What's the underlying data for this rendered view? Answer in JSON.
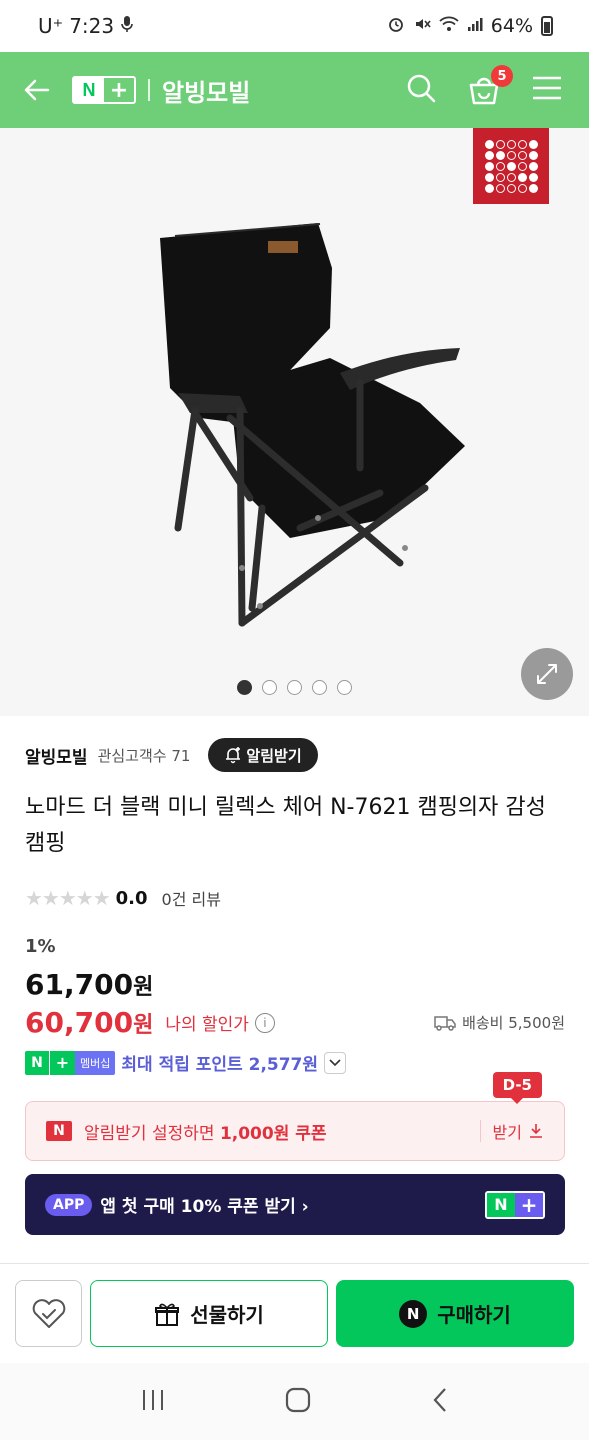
{
  "status_bar": {
    "carrier": "U⁺",
    "time": "7:23",
    "battery": "64%",
    "icons": [
      "mic-icon",
      "alarm-icon",
      "mute-icon",
      "wifi-icon",
      "signal-icon",
      "battery-icon"
    ]
  },
  "header": {
    "logo_n": "N",
    "logo_plus": "+",
    "store_name": "알빙모빌",
    "cart_count": "5",
    "accent_color": "#6fcf79"
  },
  "gallery": {
    "image_count": 5,
    "active_index": 0
  },
  "store": {
    "name": "알빙모빌",
    "followers": "관심고객수 71",
    "alert_label": "알림받기"
  },
  "product": {
    "title": "노마드 더 블랙 미니 릴렉스 체어 N-7621 캠핑의자 감성캠핑",
    "rating": "0.0",
    "review_count": "0건 리뷰",
    "discount_rate": "1%",
    "original_price": "61,700",
    "sale_price": "60,700",
    "currency": "원",
    "my_sale_label": "나의 할인가",
    "shipping": "배송비 5,500원"
  },
  "membership": {
    "n": "N",
    "plus": "+",
    "member_label": "멤버십",
    "points_text": "최대 적립 포인트 2,577원"
  },
  "coupon": {
    "n": "N",
    "text_prefix": "알림받기 설정하면 ",
    "text_bold": "1,000원 쿠폰",
    "receive_label": "받기",
    "d_day": "D-5"
  },
  "app_banner": {
    "tag": "APP",
    "text": "앱 첫 구매 10% 쿠폰 받기 ›",
    "n": "N",
    "plus": "+"
  },
  "actions": {
    "gift_label": "선물하기",
    "buy_label": "구매하기",
    "buy_n": "N"
  },
  "colors": {
    "naver_green": "#03c75a",
    "sale_red": "#e0313d",
    "member_purple": "#5a5fd6"
  }
}
